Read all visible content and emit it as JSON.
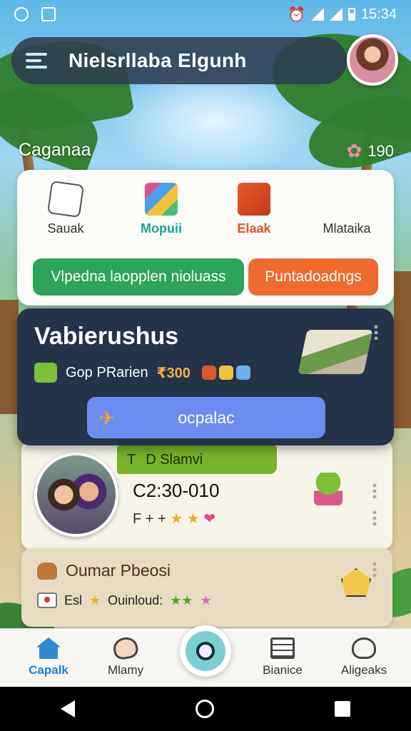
{
  "status_bar": {
    "time": "15:34"
  },
  "header": {
    "title": "Nielsrllaba Elgunh"
  },
  "location": {
    "name": "Caganaa",
    "points": "190"
  },
  "categories": {
    "items": [
      {
        "label": "Sauak",
        "icon": "star-badge-icon"
      },
      {
        "label": "Mopuii",
        "icon": "books-icon"
      },
      {
        "label": "Elaak",
        "icon": "box-icon"
      },
      {
        "label": "Mlataika",
        "icon": ""
      }
    ],
    "button_primary": "Vlpedna laopplen nioluass",
    "button_secondary": "Puntadoadngs"
  },
  "featured": {
    "title": "Vabierushus",
    "subtitle": "Gop PRarien",
    "price": "₹300",
    "cta_label": "ocpalac"
  },
  "post": {
    "tag": "D Slamvi",
    "tag_prefix": "T",
    "time_range": "C2:30-010",
    "meta": "F + +"
  },
  "lower_card": {
    "title": "Oumar Pbeosi",
    "row_label": "Esl",
    "row_text": "Ouinloud:"
  },
  "bottom_nav": {
    "items": [
      {
        "label": "Capalk",
        "icon": "home-icon",
        "active": true
      },
      {
        "label": "Mlamy",
        "icon": "heart-icon",
        "active": false
      },
      {
        "label": "Bianice",
        "icon": "document-icon",
        "active": false
      },
      {
        "label": "Aligeaks",
        "icon": "user-icon",
        "active": false
      }
    ]
  },
  "colors": {
    "accent_blue": "#6b8cf0",
    "green": "#2ea35a",
    "orange": "#ee6a2e",
    "dark_card": "#253349"
  }
}
